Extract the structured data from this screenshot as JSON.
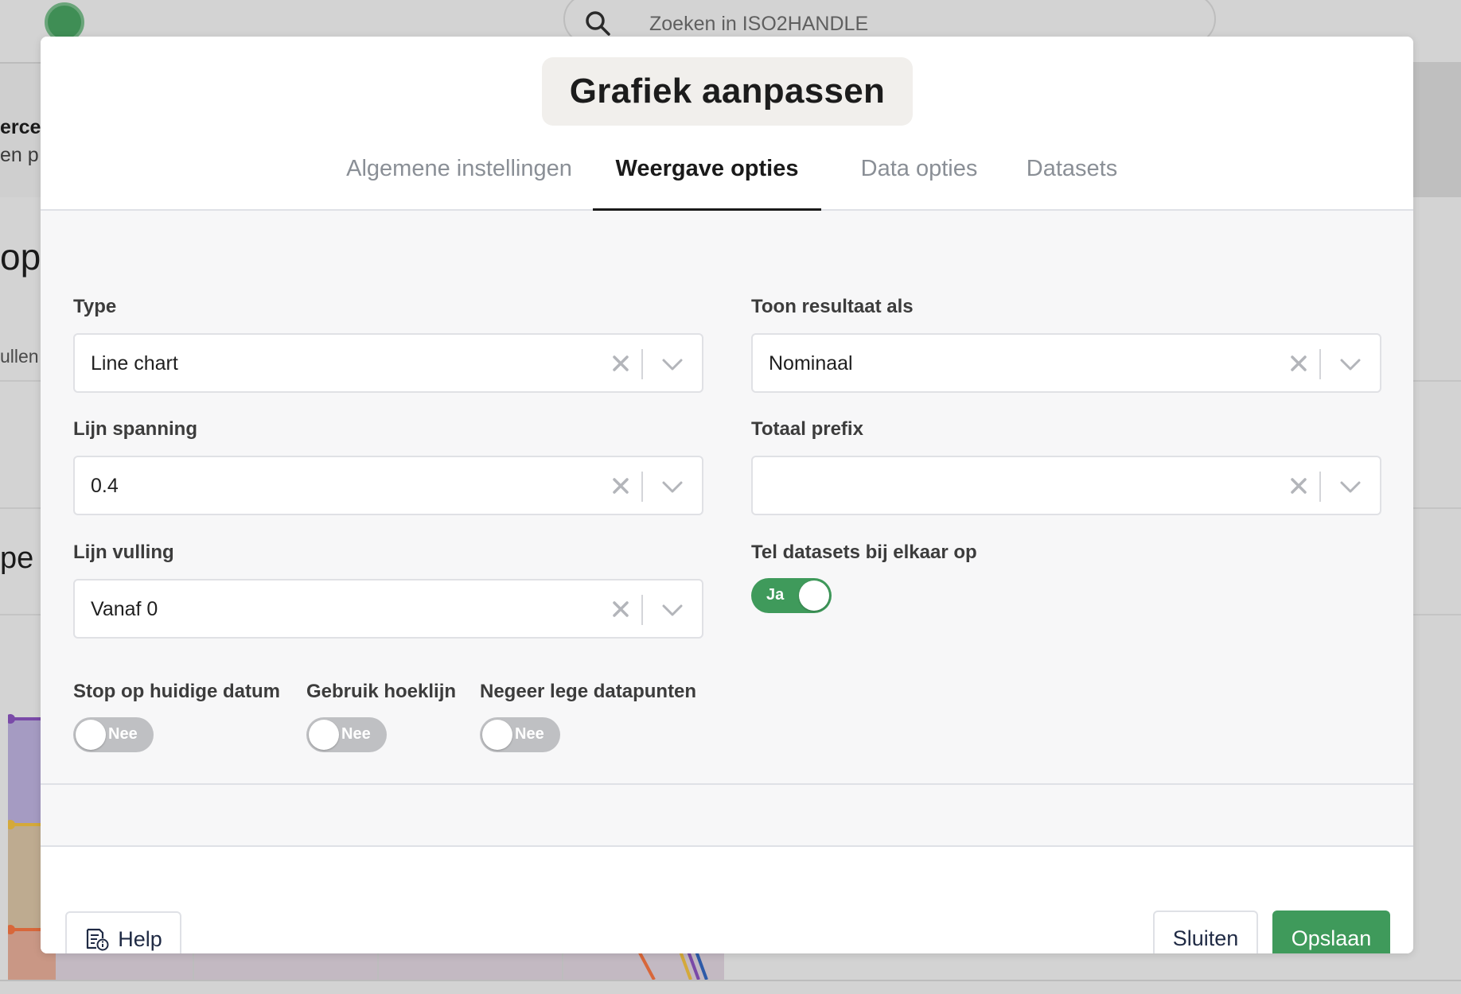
{
  "background": {
    "search_placeholder": "Zoeken in ISO2HANDLE",
    "fragments": [
      "erce",
      "en p",
      "ope",
      "ullen",
      "pe"
    ]
  },
  "modal": {
    "title": "Grafiek aanpassen",
    "tabs": [
      {
        "label": "Algemene instellingen",
        "active": false
      },
      {
        "label": "Weergave opties",
        "active": true
      },
      {
        "label": "Data opties",
        "active": false
      },
      {
        "label": "Datasets",
        "active": false
      }
    ],
    "fields": {
      "type": {
        "label": "Type",
        "value": "Line chart"
      },
      "lijn_spanning": {
        "label": "Lijn spanning",
        "value": "0.4"
      },
      "lijn_vulling": {
        "label": "Lijn vulling",
        "value": "Vanaf 0"
      },
      "toon_resultaat": {
        "label": "Toon resultaat als",
        "value": "Nominaal"
      },
      "totaal_prefix": {
        "label": "Totaal prefix",
        "value": ""
      },
      "tel_datasets": {
        "label": "Tel datasets bij elkaar op",
        "state": "Ja"
      },
      "stop_datum": {
        "label": "Stop op huidige datum",
        "state": "Nee"
      },
      "hoeklijn": {
        "label": "Gebruik hoeklijn",
        "state": "Nee"
      },
      "negeer_leeg": {
        "label": "Negeer lege datapunten",
        "state": "Nee"
      }
    },
    "footer": {
      "help_label": "Help",
      "close_label": "Sluiten",
      "save_label": "Opslaan"
    }
  },
  "colors": {
    "accent_green": "#3f9a5b",
    "toggle_off": "#bfc0c3"
  }
}
